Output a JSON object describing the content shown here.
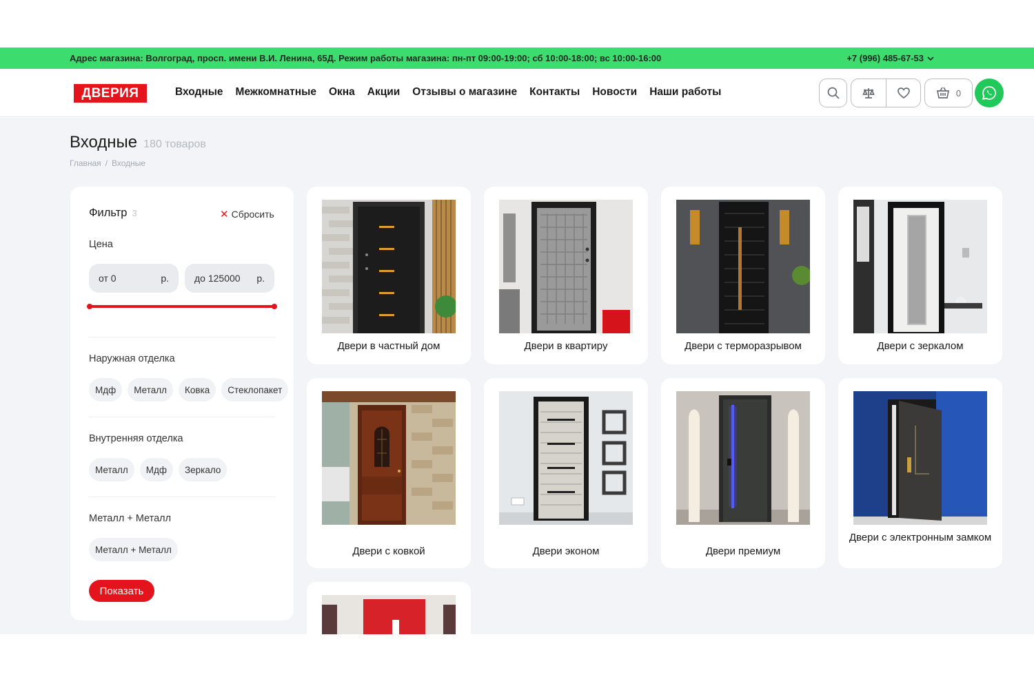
{
  "infobar": {
    "address": "Адрес магазина: Волгоград, просп. имени В.И. Ленина, 65Д. Режим работы магазина: пн-пт 09:00-19:00; сб 10:00-18:00; вс 10:00-16:00",
    "phone": "+7 (996) 485-67-53"
  },
  "header": {
    "logo": "ДВЕРИЯ",
    "nav": [
      "Входные",
      "Межкомнатные",
      "Окна",
      "Акции",
      "Отзывы о магазине",
      "Контакты",
      "Новости",
      "Наши работы"
    ],
    "cart_count": "0"
  },
  "page": {
    "title": "Входные",
    "count": "180 товаров",
    "breadcrumb": [
      "Главная",
      "/",
      "Входные"
    ]
  },
  "filter": {
    "title": "Фильтр",
    "count": "3",
    "reset": "Сбросить",
    "price_label": "Цена",
    "price_from": "от 0",
    "price_to": "до 125000",
    "currency": "р.",
    "outer_label": "Наружная отделка",
    "outer_tags": [
      "Мдф",
      "Металл",
      "Ковка",
      "Стеклопакет"
    ],
    "inner_label": "Внутренняя отделка",
    "inner_tags": [
      "Металл",
      "Мдф",
      "Зеркало"
    ],
    "mm_label": "Металл + Металл",
    "mm_tags": [
      "Металл + Металл"
    ],
    "show": "Показать"
  },
  "products": [
    "Двери в частный дом",
    "Двери в квартиру",
    "Двери с терморазрывом",
    "Двери с зеркалом",
    "Двери с ковкой",
    "Двери эконом",
    "Двери премиум",
    "Двери с электронным замком"
  ],
  "colors": {
    "accent_red": "#e3141b",
    "bar_green": "#3ddc6e",
    "whatsapp_green": "#21c85a"
  }
}
